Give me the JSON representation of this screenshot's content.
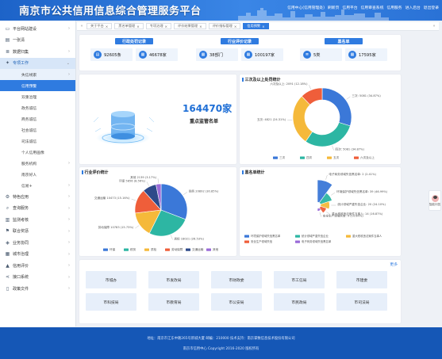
{
  "header": {
    "title": "南京市公共信用信息综合管理服务平台",
    "links": [
      "信用中心(信用管理处)",
      "刷新页",
      "信用平台",
      "信用审查系统",
      "信用服务",
      "进入后台",
      "退出登录"
    ]
  },
  "sidebar": {
    "items": [
      {
        "label": "平台网站建设",
        "icon": "monitor-icon",
        "active": false
      },
      {
        "label": "一张清",
        "icon": "document-icon",
        "active": false
      },
      {
        "label": "数据归集",
        "icon": "database-icon",
        "active": false
      },
      {
        "label": "专项工作",
        "icon": "star-icon",
        "active": true
      }
    ],
    "sub_items": [
      {
        "label": "失信线索",
        "state": "open"
      },
      {
        "label": "信用预警",
        "state": "selected"
      },
      {
        "label": "双重治理",
        "state": ""
      },
      {
        "label": "政务诚信",
        "state": ""
      },
      {
        "label": "商务诚信",
        "state": ""
      },
      {
        "label": "社会诚信",
        "state": ""
      },
      {
        "label": "司法诚信",
        "state": ""
      },
      {
        "label": "个人信用画像",
        "state": ""
      },
      {
        "label": "服务机构",
        "state": "open"
      },
      {
        "label": "南京好人",
        "state": ""
      },
      {
        "label": "信易+",
        "state": ""
      }
    ],
    "bottom_items": [
      {
        "label": "特色应用",
        "icon": "gear-icon"
      },
      {
        "label": "查询服务",
        "icon": "search-icon"
      },
      {
        "label": "监测考核",
        "icon": "chart-icon"
      },
      {
        "label": "联合奖惩",
        "icon": "flag-icon"
      },
      {
        "label": "业务协同",
        "icon": "shield-icon"
      },
      {
        "label": "城市治理",
        "icon": "city-icon"
      },
      {
        "label": "信用评价",
        "icon": "thumb-icon"
      },
      {
        "label": "接口系统",
        "icon": "share-icon"
      },
      {
        "label": "政策文件",
        "icon": "book-icon"
      }
    ]
  },
  "tabs": [
    {
      "label": "关于平台",
      "active": false
    },
    {
      "label": "黑名单管理",
      "active": false
    },
    {
      "label": "专项治理",
      "active": false
    },
    {
      "label": "评价结果管理",
      "active": false
    },
    {
      "label": "评价指标管理",
      "active": false
    },
    {
      "label": "信用预警",
      "active": true
    }
  ],
  "stats": {
    "groups": [
      {
        "title": "行政处罚记录",
        "boxes": [
          {
            "value": "92605条",
            "icon": "document-icon"
          },
          {
            "value": "46678家",
            "icon": "building-icon"
          }
        ]
      },
      {
        "title": "行业评价记录",
        "boxes": [
          {
            "value": "38部门",
            "icon": "building-icon"
          },
          {
            "value": "100197家",
            "icon": "building-icon"
          }
        ]
      },
      {
        "title": "黑名单",
        "boxes": [
          {
            "value": "5类",
            "icon": "list-icon"
          },
          {
            "value": "17595家",
            "icon": "building-icon"
          }
        ]
      }
    ]
  },
  "monitor": {
    "value": "164470家",
    "label": "重点监管名单"
  },
  "level_chart": {
    "title": "三次及以上处罚统计"
  },
  "industry_chart": {
    "title": "行业评价统计"
  },
  "blacklist_chart": {
    "title": "黑名单统计"
  },
  "departments": {
    "more_label": "更多",
    "row1": [
      "市城办",
      "市发改局",
      "市财政委",
      "市工信局",
      "市建委"
    ],
    "row2": [
      "市科技局",
      "市教育局",
      "市公安局",
      "市民政局",
      "市司法局"
    ]
  },
  "footer": {
    "line1": "地址：南京市江东中路265号新城大厦   邮编：210000   技术支持：南京掌数信息技术股份有限公司",
    "line2": "南京市信用中心 Copyright 2016-2020 版权所有"
  },
  "float_button": {
    "label": "智能问答"
  },
  "chart_data": [
    {
      "type": "pie",
      "title": "三次及以上处罚统计",
      "style": "donut",
      "categories": [
        "三次",
        "四次",
        "五次",
        "六次及以上"
      ],
      "values": [
        5081,
        5081,
        4821,
        2091
      ],
      "labels": [
        "三次: 5081 (34.87%)",
        "四次: 5081 (34.87%)",
        "五次: 4821 (24.31%)",
        "六次及以上: 2091 (12.18%)"
      ],
      "legend": "bottom-center",
      "colors": [
        "#3b78d8",
        "#2db6a3",
        "#f5b93a",
        "#ef5e3a"
      ]
    },
    {
      "type": "pie",
      "title": "行业评价统计",
      "categories": [
        "环保",
        "税务",
        "质检",
        "劳动保障",
        "交通运输",
        "其他"
      ],
      "values": [
        30.85,
        26.53,
        15.73,
        15.16,
        8.56,
        3.17
      ],
      "labels": [
        "税务 20892 (30.85%)",
        "质检 18021 (26.53%)",
        "劳动保障 10783 (15.73%)",
        "交通运输 10473 (15.16%)",
        "环保 5856 (8.56%)",
        "其他 2139 (3.17%)"
      ],
      "legend": "bottom-center",
      "colors": [
        "#3b78d8",
        "#2db6a3",
        "#f5b93a",
        "#ef5e3a",
        "#2e4a8a",
        "#9a6bd8"
      ]
    },
    {
      "type": "pie",
      "title": "黑名单统计",
      "style": "rose",
      "categories": [
        "环境保护领域失信黑名单",
        "统计领域严重失信企业",
        "重大税收违法案件当事人",
        "安全生产领域失信",
        "电子商务领域失信黑名单"
      ],
      "values": [
        39,
        20,
        14,
        9,
        2
      ],
      "labels": [
        "电子商务领域失信黑名单: 2 (2.41%)",
        "环境保护领域失信黑名单: 39 (46.99%)",
        "统计领域严重失信企业: 20 (24.10%)",
        "重大税收违法案件当事人: 14 (16.87%)",
        "安全生产领域失信: 9 (10.84%)"
      ],
      "legend": "bottom-left",
      "colors": [
        "#3b78d8",
        "#2db6a3",
        "#f5b93a",
        "#ef5e3a",
        "#9a6bd8"
      ]
    }
  ]
}
